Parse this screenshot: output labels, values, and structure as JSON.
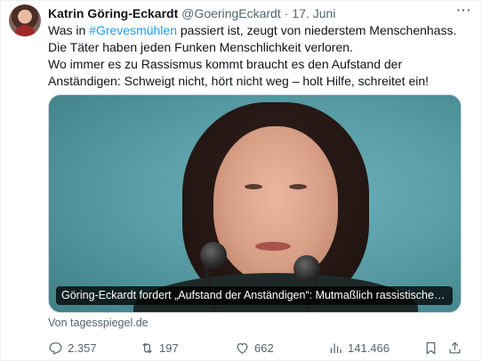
{
  "tweet": {
    "author_name": "Katrin Göring-Eckardt",
    "handle": "@GoeringEckardt",
    "separator": "·",
    "date": "17. Juni",
    "more_label": "···",
    "text": {
      "line1_prefix": "Was in ",
      "hashtag": "#Grevesmühlen",
      "line1_suffix": " passiert ist, zeugt von niederstem Menschenhass.",
      "line2": "Die Täter haben jeden Funken Menschlichkeit verloren.",
      "line3": "Wo immer es zu Rassismus kommt braucht es den Aufstand der",
      "line4": "Anständigen: Schweigt nicht, hört nicht weg – holt Hilfe, schreitet ein!"
    },
    "card": {
      "caption": "Göring-Eckardt fordert „Aufstand der Anständigen“: Mutmaßlich rassistische At...",
      "source": "Von tagesspiegel.de"
    },
    "actions": {
      "replies": "2.357",
      "retweets": "197",
      "likes": "662",
      "views": "141.466"
    },
    "colors": {
      "link": "#1d9bf0",
      "secondary_text": "#536471",
      "primary_text": "#0f1419"
    },
    "icons": [
      "reply-icon",
      "retweet-icon",
      "like-icon",
      "views-icon",
      "bookmark-icon",
      "share-icon",
      "more-icon"
    ]
  }
}
